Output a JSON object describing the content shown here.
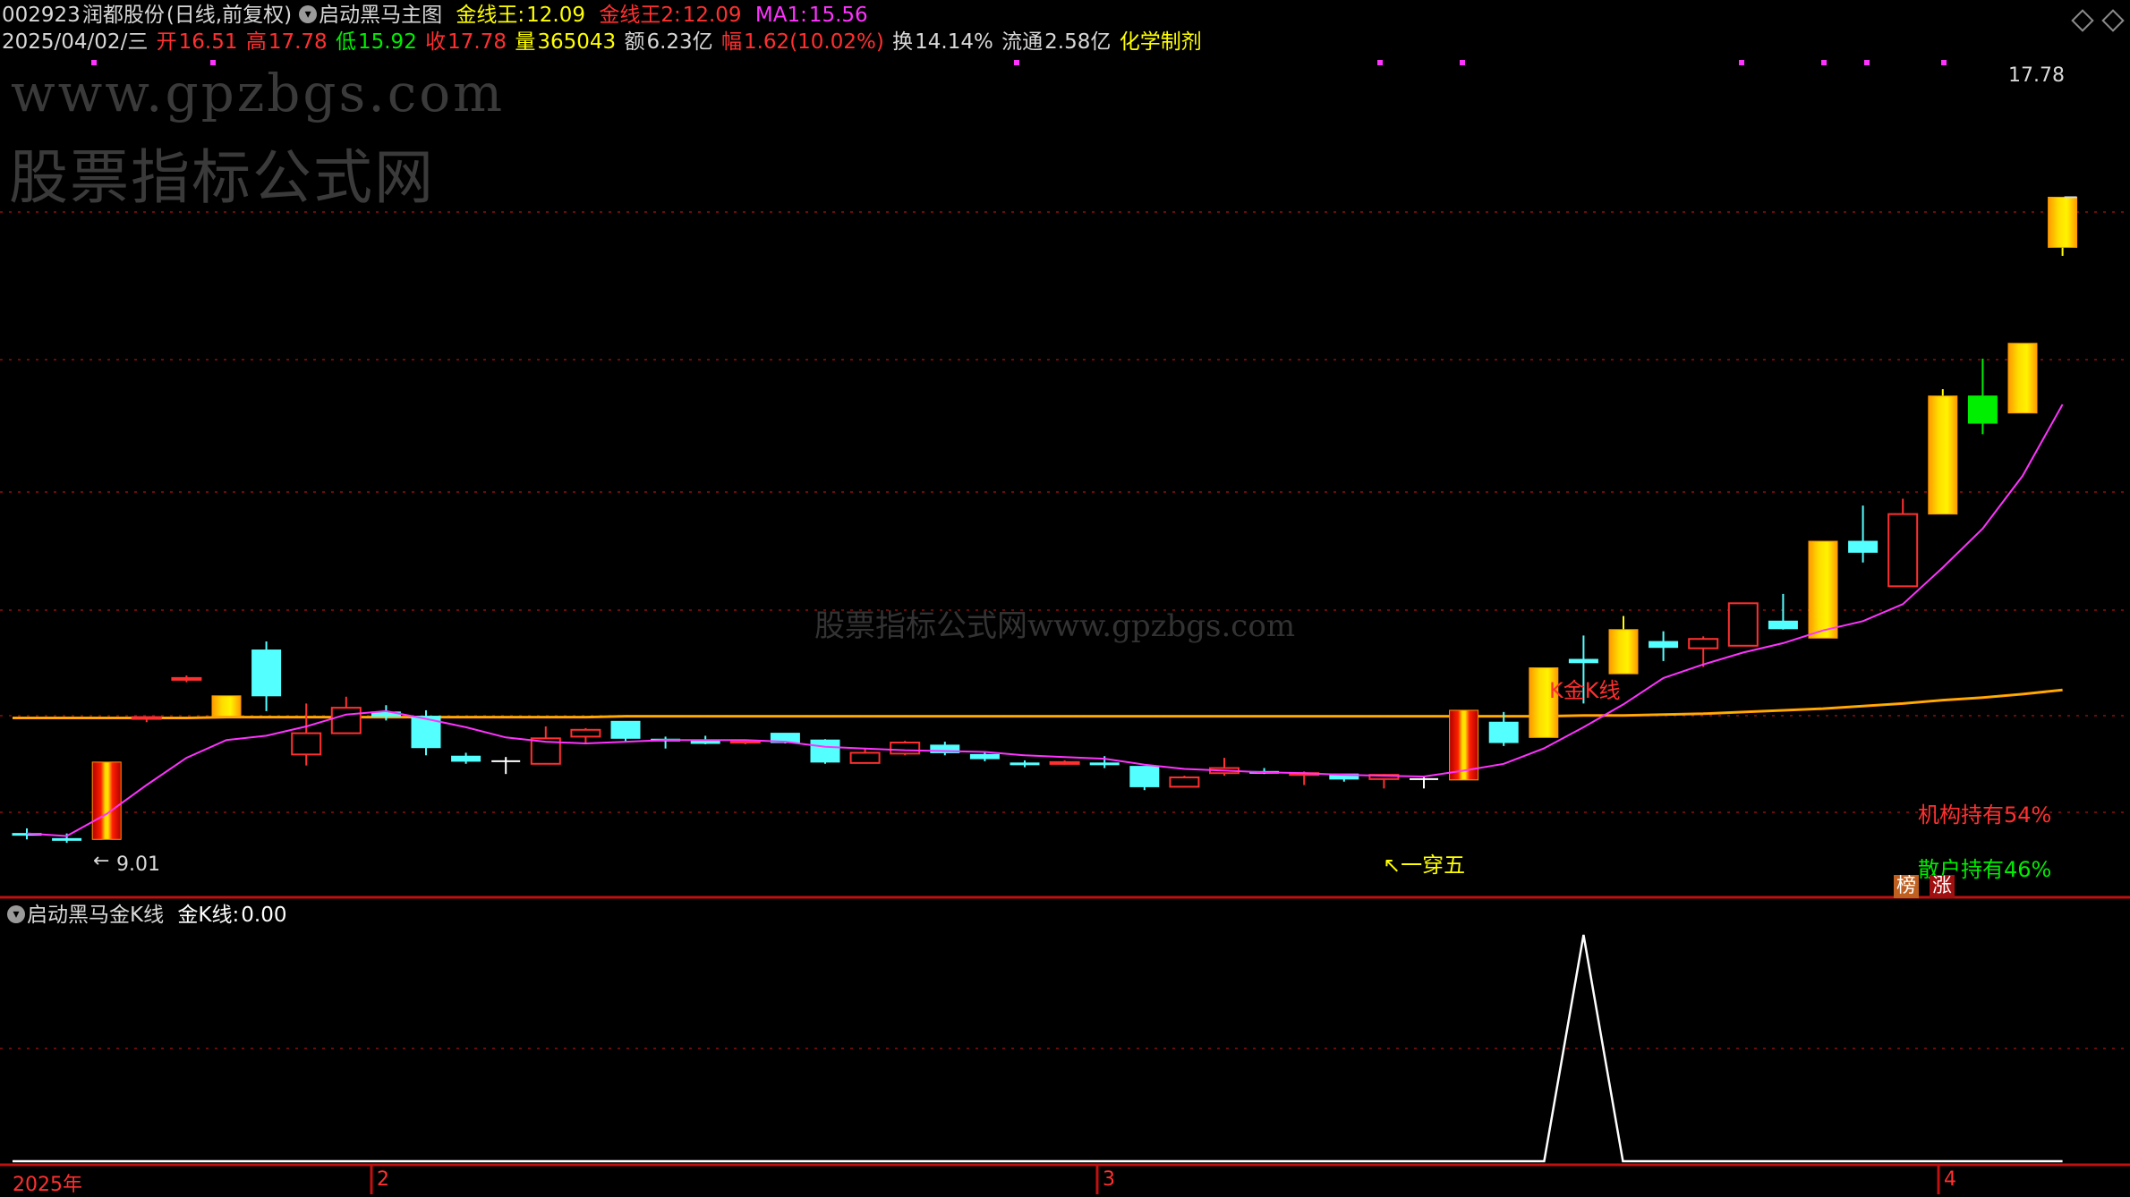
{
  "header": {
    "stock_code": "002923",
    "stock_name": "润都股份",
    "period": "(日线,前复权)",
    "indicator_name": "启动黑马主图",
    "gold_line_label": "金线王:",
    "gold_line_value": "12.09",
    "gold_line2_label": "金线王2:",
    "gold_line2_value": "12.09",
    "ma_label": "MA1:",
    "ma_value": "15.56"
  },
  "quote": {
    "date": "2025/04/02/三",
    "open_label": "开",
    "open": "16.51",
    "high_label": "高",
    "high": "17.78",
    "low_label": "低",
    "low": "15.92",
    "close_label": "收",
    "close": "17.78",
    "volume_label": "量",
    "volume": "365043",
    "amount_label": "额",
    "amount": "6.23亿",
    "change_label": "幅",
    "change": "1.62(10.02%)",
    "turnover_label": "换",
    "turnover": "14.14%",
    "float_label": "流通",
    "float": "2.58亿",
    "industry": "化学制剂"
  },
  "watermark": {
    "url": "www.gpzbgs.com",
    "site": "股票指标公式网",
    "center": "股票指标公式网www.gpzbgs.com"
  },
  "annotations": {
    "high_marker": "17.78",
    "low_marker": "9.01",
    "gold_k": "K金K线",
    "one_through_five": "↖一穿五",
    "institution": "机构持有54%",
    "retail": "散户持有46%",
    "badge1": "榜",
    "badge2": "涨"
  },
  "sub_panel": {
    "title": "启动黑马金K线",
    "label": "金K线:",
    "value": "0.00"
  },
  "time_axis": {
    "labels": [
      "2025年",
      "2",
      "3",
      "4"
    ]
  },
  "colors": {
    "up": "#ff3030",
    "down": "#54ffff",
    "gold_up": "#ffff00",
    "green_bar": "#00ee00",
    "ma": "#ff33ff",
    "gold_line": "#ff9900",
    "grid": "#8a1010",
    "axis": "#c01010"
  },
  "chart_data": {
    "type": "candlestick",
    "ylim": [
      8.4,
      18.3
    ],
    "candles": [
      {
        "o": 9.12,
        "h": 9.18,
        "l": 9.05,
        "c": 9.1,
        "style": "down"
      },
      {
        "o": 9.06,
        "h": 9.12,
        "l": 9.01,
        "c": 9.05,
        "style": "down"
      },
      {
        "o": 9.05,
        "h": 9.96,
        "l": 9.05,
        "c": 9.96,
        "style": "gold"
      },
      {
        "o": 10.49,
        "h": 10.49,
        "l": 10.43,
        "c": 10.49,
        "style": "up"
      },
      {
        "o": 10.95,
        "h": 10.98,
        "l": 10.9,
        "c": 10.95,
        "style": "up"
      },
      {
        "o": 10.74,
        "h": 10.74,
        "l": 10.5,
        "c": 10.5,
        "style": "gold"
      },
      {
        "o": 11.28,
        "h": 11.38,
        "l": 10.56,
        "c": 10.74,
        "style": "down"
      },
      {
        "o": 10.05,
        "h": 10.65,
        "l": 9.92,
        "c": 10.3,
        "style": "up"
      },
      {
        "o": 10.3,
        "h": 10.73,
        "l": 10.3,
        "c": 10.6,
        "style": "up"
      },
      {
        "o": 10.55,
        "h": 10.63,
        "l": 10.45,
        "c": 10.5,
        "style": "down"
      },
      {
        "o": 10.5,
        "h": 10.57,
        "l": 10.04,
        "c": 10.13,
        "style": "down"
      },
      {
        "o": 10.03,
        "h": 10.07,
        "l": 9.94,
        "c": 9.97,
        "style": "down"
      },
      {
        "o": 9.97,
        "h": 10.02,
        "l": 9.82,
        "c": 9.97,
        "style": "cross"
      },
      {
        "o": 9.94,
        "h": 10.38,
        "l": 9.94,
        "c": 10.24,
        "style": "up"
      },
      {
        "o": 10.26,
        "h": 10.36,
        "l": 10.17,
        "c": 10.34,
        "style": "up"
      },
      {
        "o": 10.44,
        "h": 10.44,
        "l": 10.2,
        "c": 10.24,
        "style": "down"
      },
      {
        "o": 10.23,
        "h": 10.26,
        "l": 10.12,
        "c": 10.23,
        "style": "down"
      },
      {
        "o": 10.21,
        "h": 10.27,
        "l": 10.17,
        "c": 10.18,
        "style": "down"
      },
      {
        "o": 10.2,
        "h": 10.22,
        "l": 10.17,
        "c": 10.21,
        "style": "up"
      },
      {
        "o": 10.3,
        "h": 10.3,
        "l": 10.18,
        "c": 10.19,
        "style": "down"
      },
      {
        "o": 10.22,
        "h": 10.23,
        "l": 9.94,
        "c": 9.96,
        "style": "down"
      },
      {
        "o": 9.95,
        "h": 10.12,
        "l": 9.95,
        "c": 10.07,
        "style": "up"
      },
      {
        "o": 10.06,
        "h": 10.21,
        "l": 10.04,
        "c": 10.19,
        "style": "up"
      },
      {
        "o": 10.16,
        "h": 10.2,
        "l": 10.04,
        "c": 10.07,
        "style": "down"
      },
      {
        "o": 10.05,
        "h": 10.08,
        "l": 9.97,
        "c": 10.0,
        "style": "down"
      },
      {
        "o": 9.95,
        "h": 9.98,
        "l": 9.9,
        "c": 9.93,
        "style": "down"
      },
      {
        "o": 9.95,
        "h": 9.98,
        "l": 9.93,
        "c": 9.96,
        "style": "up"
      },
      {
        "o": 9.95,
        "h": 10.03,
        "l": 9.89,
        "c": 9.95,
        "style": "down"
      },
      {
        "o": 9.91,
        "h": 9.91,
        "l": 9.63,
        "c": 9.67,
        "style": "down"
      },
      {
        "o": 9.67,
        "h": 9.8,
        "l": 9.67,
        "c": 9.78,
        "style": "up"
      },
      {
        "o": 9.83,
        "h": 10.01,
        "l": 9.8,
        "c": 9.89,
        "style": "up"
      },
      {
        "o": 9.83,
        "h": 9.89,
        "l": 9.82,
        "c": 9.85,
        "style": "down"
      },
      {
        "o": 9.83,
        "h": 9.85,
        "l": 9.69,
        "c": 9.83,
        "style": "up"
      },
      {
        "o": 9.82,
        "h": 9.82,
        "l": 9.73,
        "c": 9.76,
        "style": "down"
      },
      {
        "o": 9.76,
        "h": 9.82,
        "l": 9.65,
        "c": 9.81,
        "style": "up"
      },
      {
        "o": 9.76,
        "h": 9.8,
        "l": 9.65,
        "c": 9.76,
        "style": "cross"
      },
      {
        "o": 9.75,
        "h": 10.57,
        "l": 9.75,
        "c": 10.57,
        "style": "gold"
      },
      {
        "o": 10.43,
        "h": 10.55,
        "l": 10.15,
        "c": 10.19,
        "style": "down"
      },
      {
        "o": 10.25,
        "h": 11.07,
        "l": 10.25,
        "c": 11.07,
        "style": "gold"
      },
      {
        "o": 11.13,
        "h": 11.45,
        "l": 10.65,
        "c": 11.17,
        "style": "down"
      },
      {
        "o": 11.0,
        "h": 11.68,
        "l": 11.0,
        "c": 11.52,
        "style": "gold"
      },
      {
        "o": 11.38,
        "h": 11.5,
        "l": 11.15,
        "c": 11.31,
        "style": "down"
      },
      {
        "o": 11.3,
        "h": 11.44,
        "l": 11.08,
        "c": 11.41,
        "style": "up"
      },
      {
        "o": 11.33,
        "h": 11.83,
        "l": 11.33,
        "c": 11.83,
        "style": "up"
      },
      {
        "o": 11.62,
        "h": 11.94,
        "l": 11.52,
        "c": 11.53,
        "style": "down"
      },
      {
        "o": 11.42,
        "h": 12.56,
        "l": 11.42,
        "c": 12.56,
        "style": "gold"
      },
      {
        "o": 12.56,
        "h": 12.98,
        "l": 12.31,
        "c": 12.43,
        "style": "down"
      },
      {
        "o": 12.03,
        "h": 13.06,
        "l": 12.03,
        "c": 12.88,
        "style": "up"
      },
      {
        "o": 12.88,
        "h": 14.35,
        "l": 12.88,
        "c": 14.27,
        "style": "gold"
      },
      {
        "o": 14.27,
        "h": 14.71,
        "l": 13.82,
        "c": 13.95,
        "style": "green"
      },
      {
        "o": 14.07,
        "h": 14.89,
        "l": 14.07,
        "c": 14.89,
        "style": "gold"
      },
      {
        "o": 16.02,
        "h": 16.61,
        "l": 15.92,
        "c": 16.61,
        "style": "gold"
      }
    ],
    "ma": [
      9.12,
      9.09,
      9.35,
      9.69,
      10.01,
      10.22,
      10.27,
      10.38,
      10.52,
      10.56,
      10.47,
      10.37,
      10.25,
      10.2,
      10.18,
      10.2,
      10.22,
      10.22,
      10.22,
      10.2,
      10.14,
      10.12,
      10.1,
      10.09,
      10.08,
      10.04,
      10.02,
      10.0,
      9.93,
      9.88,
      9.86,
      9.84,
      9.83,
      9.81,
      9.8,
      9.79,
      9.86,
      9.94,
      10.12,
      10.37,
      10.64,
      10.95,
      11.11,
      11.25,
      11.36,
      11.51,
      11.62,
      11.82,
      12.25,
      12.71,
      13.33,
      14.17
    ],
    "gold_line": [
      10.48,
      10.48,
      10.48,
      10.48,
      10.48,
      10.49,
      10.49,
      10.49,
      10.49,
      10.49,
      10.49,
      10.49,
      10.49,
      10.49,
      10.49,
      10.5,
      10.5,
      10.5,
      10.5,
      10.5,
      10.5,
      10.5,
      10.5,
      10.5,
      10.5,
      10.5,
      10.5,
      10.5,
      10.5,
      10.5,
      10.5,
      10.5,
      10.5,
      10.5,
      10.5,
      10.5,
      10.5,
      10.5,
      10.5,
      10.51,
      10.51,
      10.52,
      10.53,
      10.55,
      10.57,
      10.59,
      10.62,
      10.65,
      10.69,
      10.72,
      10.76,
      10.81
    ],
    "sub_signal": {
      "ylim": [
        0,
        1
      ],
      "values": [
        0,
        0,
        0,
        0,
        0,
        0,
        0,
        0,
        0,
        0,
        0,
        0,
        0,
        0,
        0,
        0,
        0,
        0,
        0,
        0,
        0,
        0,
        0,
        0,
        0,
        0,
        0,
        0,
        0,
        0,
        0,
        0,
        0,
        0,
        0,
        0,
        0,
        0,
        0,
        1,
        0,
        0,
        0,
        0,
        0,
        0,
        0,
        0,
        0,
        0,
        0,
        0
      ]
    }
  }
}
